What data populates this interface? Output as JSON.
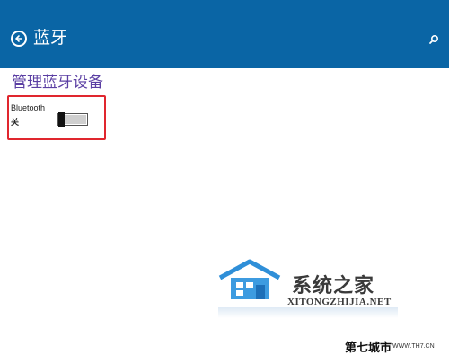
{
  "header": {
    "title": "蓝牙",
    "back_icon": "back-arrow-icon",
    "search_icon": "search-icon",
    "background": "#0a65a5"
  },
  "section": {
    "title": "管理蓝牙设备",
    "color": "#5b3fa3"
  },
  "bluetooth": {
    "label": "Bluetooth",
    "state": "关",
    "enabled": false
  },
  "highlight_color": "#e0262e",
  "watermark": {
    "brand_cn": "系统之家",
    "brand_en": "XITONGZHIJIA.NET",
    "corner_brand": "第七城市",
    "corner_url": "WWW.TH7.CN"
  }
}
